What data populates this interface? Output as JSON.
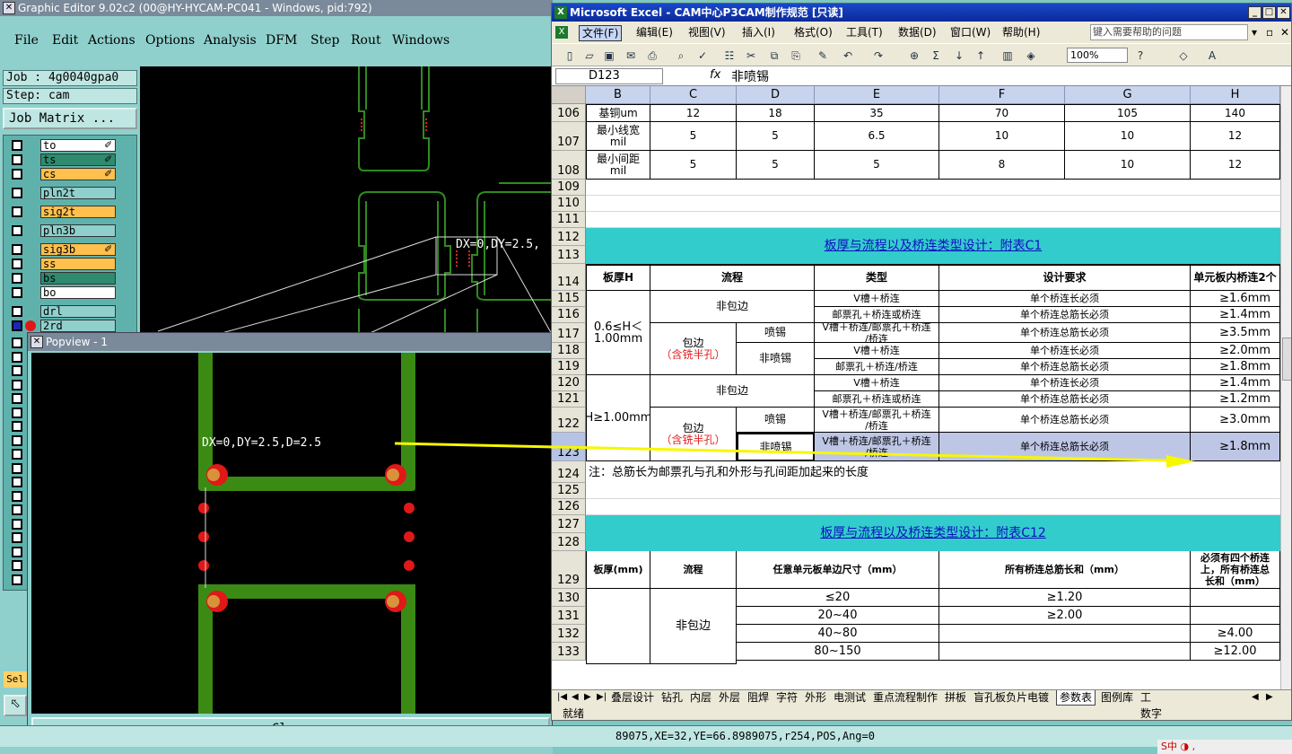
{
  "graphic_editor": {
    "title": "Graphic Editor 9.02c2 (00@HY-HYCAM-PC041 - Windows, pid:792)",
    "menu": [
      "File",
      "Edit",
      "Actions",
      "Options",
      "Analysis",
      "DFM",
      "Step",
      "Rout",
      "Windows"
    ],
    "job": "Job : 4g0040gpa0",
    "step": "Step: cam",
    "job_matrix": "Job Matrix ...",
    "layers": [
      {
        "name": "to",
        "color": "#ffffff",
        "flag": "✐"
      },
      {
        "name": "ts",
        "color": "#2e8b6e",
        "flag": "✐"
      },
      {
        "name": "cs",
        "color": "#ffc04d",
        "flag": "✐"
      },
      {
        "name": "pln2t",
        "color": "#8fd0cc",
        "flag": ""
      },
      {
        "name": "sig2t",
        "color": "#ffc04d",
        "flag": ""
      },
      {
        "name": "pln3b",
        "color": "#8fd0cc",
        "flag": ""
      },
      {
        "name": "sig3b",
        "color": "#ffc04d",
        "flag": "✐"
      },
      {
        "name": "ss",
        "color": "#ffc04d",
        "flag": ""
      },
      {
        "name": "bs",
        "color": "#2e8b6e",
        "flag": ""
      },
      {
        "name": "bo",
        "color": "#ffffff",
        "flag": ""
      },
      {
        "name": "drl",
        "color": "#8fd0cc",
        "flag": ""
      },
      {
        "name": "2rd",
        "color": "#8fd0cc",
        "flag": ""
      }
    ],
    "canvas_label": "DX=0,DY=2.5,",
    "sel_label": "Sel",
    "status_text": "89075,XE=32,YE=66.8989075,r254,POS,Ang=0"
  },
  "popview": {
    "title": "Popview - 1",
    "measure_label": "DX=0,DY=2.5,D=2.5",
    "close_label": "Close"
  },
  "excel": {
    "title": "Microsoft Excel - CAM中心P3CAM制作规范 [只读]",
    "menu": [
      "文件(F)",
      "编辑(E)",
      "视图(V)",
      "插入(I)",
      "格式(O)",
      "工具(T)",
      "数据(D)",
      "窗口(W)",
      "帮助(H)"
    ],
    "help_placeholder": "键入需要帮助的问题",
    "zoom": "100%",
    "name_box": "D123",
    "fx": "fx",
    "formula_value": "非喷锡",
    "columns": [
      "B",
      "C",
      "D",
      "E",
      "F",
      "G",
      "H"
    ],
    "rows": [
      "106",
      "107",
      "108",
      "109",
      "110",
      "111",
      "112",
      "113",
      "114",
      "115",
      "116",
      "117",
      "118",
      "119",
      "120",
      "121",
      "122",
      "123",
      "124",
      "125",
      "126",
      "127",
      "128",
      "129",
      "130",
      "131",
      "132",
      "133"
    ],
    "table1": {
      "row106": [
        "基铜um",
        "12",
        "18",
        "35",
        "70",
        "105",
        "140"
      ],
      "row107": [
        "最小线宽\nmil",
        "5",
        "5",
        "6.5",
        "10",
        "10",
        "12"
      ],
      "row108": [
        "最小间距\nmil",
        "5",
        "5",
        "5",
        "8",
        "10",
        "12"
      ]
    },
    "table2": {
      "title": "板厚与流程以及桥连类型设计：附表C1",
      "headers": [
        "板厚H",
        "流程",
        "类型",
        "设计要求",
        "单元板内桥连2个"
      ],
      "thickness_1": "0.6≤H＜\n1.00mm",
      "thickness_2": "H≥1.00mm",
      "no_edge": "非包边",
      "edge": "包边",
      "edge_note": "（含铣半孔）",
      "spray": "喷锡",
      "no_spray": "非喷锡",
      "type_v": "V槽＋桥连",
      "type_stamp": "邮票孔＋桥连或桥连",
      "type_combo": "V槽＋桥连/邮票孔＋桥连\n/桥连",
      "type_stamp2": "邮票孔＋桥连/桥连",
      "req_single": "单个桥连长必须",
      "req_total": "单个桥连总筋长必须",
      "values": [
        "≥1.6mm",
        "≥1.4mm",
        "≥3.5mm",
        "≥2.0mm",
        "≥1.8mm",
        "≥1.4mm",
        "≥1.2mm",
        "≥3.0mm",
        "≥1.8mm"
      ]
    },
    "note": "注：总筋长为邮票孔与孔和外形与孔间距加起来的长度",
    "table3": {
      "title": "板厚与流程以及桥连类型设计：附表C12",
      "headers": [
        "板厚(mm)",
        "流程",
        "任意单元板单边尺寸（mm）",
        "所有桥连总筋长和（mm）",
        "必须有四个桥连\n上，所有桥连总\n长和（mm）"
      ],
      "flow": "非包边",
      "sizes": [
        "≤20",
        "20~40",
        "40~80",
        "80~150"
      ],
      "totals": [
        "≥1.20",
        "≥2.00",
        "",
        ""
      ],
      "h_values": [
        "",
        "",
        "≥4.00",
        "≥12.00"
      ]
    },
    "sheet_tabs": [
      "叠层设计",
      "钻孔",
      "内层",
      "外层",
      "阻焊",
      "字符",
      "外形",
      "电测试",
      "重点流程制作",
      "拼板",
      "盲孔板负片电镀",
      "参数表",
      "图例库",
      "工"
    ],
    "active_tab": "参数表",
    "status_ready": "就绪",
    "status_num": "数字"
  },
  "ime": "S中 ◑ ,"
}
